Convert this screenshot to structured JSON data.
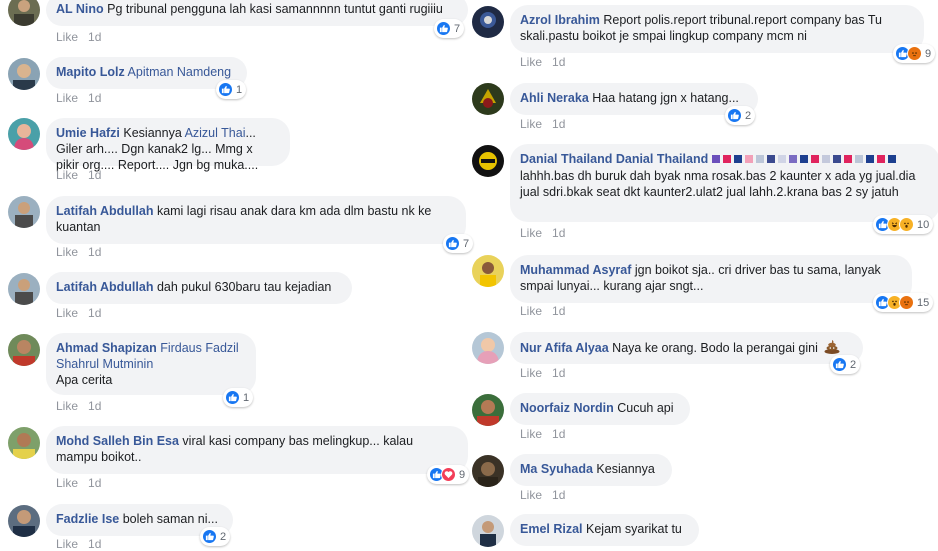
{
  "like_label": "Like",
  "time_label": "1d",
  "left": [
    {
      "author": "AL Nino",
      "tags": "",
      "text": "Pg tribunal pengguna lah kasi samannnnn tuntut ganti rugiiiu",
      "reactions": [
        "like"
      ],
      "count": "7"
    },
    {
      "author": "Mapito Lolz",
      "tags": "Apitman Namdeng",
      "text": "",
      "reactions": [
        "like"
      ],
      "count": "1"
    },
    {
      "author": "Umie Hafzi",
      "tags": "",
      "text": "Kesiannya ",
      "tag2": "Azizul Thai",
      "text2": "... Giler arh.... Dgn kanak2 lg... Mmg x pikir org.... Report.... Jgn bg muka....",
      "reactions": [],
      "count": ""
    },
    {
      "author": "Latifah Abdullah",
      "tags": "",
      "text": "kami lagi risau anak dara km ada dlm bastu nk ke kuantan",
      "reactions": [
        "like"
      ],
      "count": "7"
    },
    {
      "author": "Latifah Abdullah",
      "tags": "",
      "text": "dah pukul 630baru tau kejadian",
      "reactions": [],
      "count": ""
    },
    {
      "author": "Ahmad Shapizan",
      "tags": "Firdaus Fadzil Shahrul Mutminin",
      "text": "Apa cerita",
      "reactions": [
        "like"
      ],
      "count": "1"
    },
    {
      "author": "Mohd Salleh Bin Esa",
      "tags": "",
      "text": "viral kasi company bas melingkup... kalau mampu boikot..",
      "reactions": [
        "like",
        "love"
      ],
      "count": "9"
    },
    {
      "author": "Fadzlie Ise",
      "tags": "",
      "text": "boleh saman ni...",
      "reactions": [
        "like"
      ],
      "count": "2"
    }
  ],
  "right": [
    {
      "author": "Azrol Ibrahim",
      "tags": "",
      "text": "Report polis.report tribunal.report company bas Tu skali.pastu boikot je smpai lingkup company mcm ni",
      "reactions": [
        "like",
        "angry"
      ],
      "count": "9"
    },
    {
      "author": "Ahli Neraka",
      "tags": "",
      "text": "Haa hatang jgn x hatang...",
      "reactions": [
        "like"
      ],
      "count": "2"
    },
    {
      "author": "Danial Thailand Danial Thailand",
      "tags": "",
      "text": "lahhh.bas dh buruk dah byak nma rosak.bas 2 kaunter x ada yg jual.dia jual sdri.bkak seat dkt kaunter2.ulat2 jual lahh.2.krana bas 2 sy jatuh",
      "reactions": [
        "like",
        "haha",
        "wow"
      ],
      "count": "10"
    },
    {
      "author": "Muhammad Asyraf",
      "tags": "",
      "text": "jgn boikot sja.. cri driver bas tu sama, lanyak smpai lunyai... kurang ajar sngt...",
      "reactions": [
        "like",
        "wow",
        "angry"
      ],
      "count": "15"
    },
    {
      "author": "Nur Afifa Alyaa",
      "tags": "",
      "text": "Naya ke orang. Bodo la perangai gini",
      "reactions": [
        "like"
      ],
      "count": "2"
    },
    {
      "author": "Noorfaiz Nordin",
      "tags": "",
      "text": "Cucuh api",
      "reactions": [],
      "count": ""
    },
    {
      "author": "Ma Syuhada",
      "tags": "",
      "text": "Kesiannya",
      "reactions": [],
      "count": ""
    },
    {
      "author": "Emel Rizal",
      "tags": "",
      "text": "Kejam syarikat tu",
      "reactions": [],
      "count": ""
    }
  ],
  "colors": {
    "link": "#385898",
    "bubble": "#f2f3f5",
    "meta": "#90949c",
    "like": "#1877f2"
  }
}
